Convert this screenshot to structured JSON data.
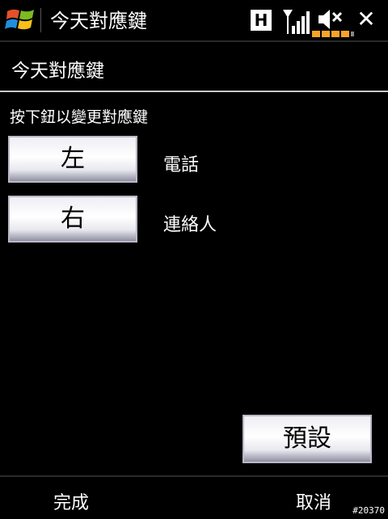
{
  "titlebar": {
    "title": "今天對應鍵",
    "network_badge": "H",
    "close_glyph": "✕"
  },
  "header": {
    "title": "今天對應鍵"
  },
  "instruction": "按下鈕以變更對應鍵",
  "mappings": [
    {
      "button": "左",
      "value": "電話"
    },
    {
      "button": "右",
      "value": "連絡人"
    }
  ],
  "default_button": "預設",
  "softkeys": {
    "left": "完成",
    "right": "取消"
  },
  "watermark": "#20370",
  "colors": {
    "background": "#000000",
    "text": "#ffffff",
    "battery": "#f7a32b"
  },
  "icons": [
    "windows-start-icon",
    "signal-strength-icon",
    "volume-muted-icon",
    "battery-icon",
    "close-icon"
  ]
}
